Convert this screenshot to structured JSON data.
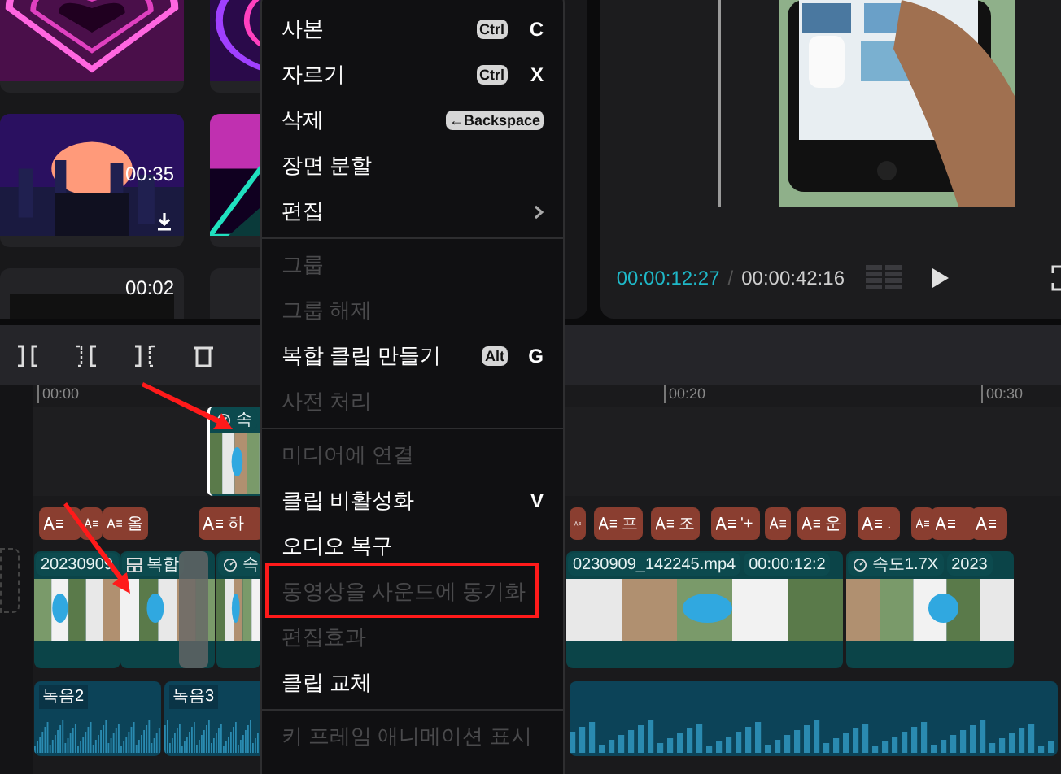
{
  "media": [
    {
      "download": false
    },
    {
      "download": false
    },
    {
      "duration": "00:35",
      "download": true
    },
    {
      "download": false
    },
    {
      "duration": "00:02",
      "download": false
    },
    {
      "download": false
    }
  ],
  "preview": {
    "current": "00:00:12:27",
    "separator": "/",
    "total": "00:00:42:16"
  },
  "ruler": [
    "00:00",
    "00:20",
    "00:30"
  ],
  "text_clips": [
    {
      "kind": "text"
    },
    {
      "kind": "text"
    },
    {
      "kind": "text",
      "label": "올"
    },
    {
      "kind": "text",
      "label": "하"
    },
    {
      "kind": "text"
    },
    {
      "kind": "text",
      "label": "프"
    },
    {
      "kind": "text",
      "label": "조"
    },
    {
      "kind": "text",
      "label": "'+"
    },
    {
      "kind": "text"
    },
    {
      "kind": "text",
      "label": "운"
    },
    {
      "kind": "text",
      "label": "."
    },
    {
      "kind": "text"
    },
    {
      "kind": "text"
    },
    {
      "kind": "text"
    }
  ],
  "video_clips": [
    {
      "tags": [
        {
          "kind": "text",
          "text": "20230909"
        }
      ]
    },
    {
      "tags": [
        {
          "kind": "compound",
          "text": "복합"
        }
      ]
    },
    {
      "tags": [
        {
          "kind": "speed",
          "text": "속"
        }
      ]
    },
    {
      "tags": [
        {
          "kind": "text",
          "text": "0230909_142245.mp4"
        },
        {
          "kind": "text",
          "text": "00:00:12:2"
        }
      ]
    },
    {
      "tags": [
        {
          "kind": "speed",
          "text": "속도1.7X"
        },
        {
          "kind": "text",
          "text": "2023"
        }
      ]
    }
  ],
  "overlay_clip": {
    "tags": [
      {
        "kind": "speed",
        "text": "속"
      }
    ]
  },
  "audio_clips": [
    {
      "kind": "audio",
      "label": "녹음2"
    },
    {
      "kind": "audio",
      "label": "녹음3"
    },
    {
      "kind": "audio"
    }
  ],
  "context_menu": [
    {
      "kind": "item",
      "label": "사본",
      "disabled": false,
      "highlighted": false,
      "key": "Ctrl",
      "letter": "C"
    },
    {
      "kind": "item",
      "label": "자르기",
      "disabled": false,
      "highlighted": false,
      "key": "Ctrl",
      "letter": "X"
    },
    {
      "kind": "item",
      "label": "삭제",
      "disabled": false,
      "highlighted": false,
      "key": "←Backspace"
    },
    {
      "kind": "item",
      "label": "장면 분할",
      "disabled": false,
      "highlighted": false
    },
    {
      "kind": "item",
      "label": "편집",
      "disabled": false,
      "highlighted": false,
      "submenu": true
    },
    {
      "kind": "separator"
    },
    {
      "kind": "item",
      "label": "그룹",
      "disabled": true,
      "highlighted": false
    },
    {
      "kind": "item",
      "label": "그룹 해제",
      "disabled": true,
      "highlighted": false
    },
    {
      "kind": "item",
      "label": "복합 클립 만들기",
      "disabled": false,
      "highlighted": false,
      "key": "Alt",
      "letter": "G"
    },
    {
      "kind": "item",
      "label": "사전 처리",
      "disabled": true,
      "highlighted": false
    },
    {
      "kind": "separator"
    },
    {
      "kind": "item",
      "label": "미디어에 연결",
      "disabled": true,
      "highlighted": false
    },
    {
      "kind": "item",
      "label": "클립 비활성화",
      "disabled": false,
      "highlighted": false,
      "letter": "V"
    },
    {
      "kind": "item",
      "label": "오디오 복구",
      "disabled": false,
      "highlighted": false
    },
    {
      "kind": "item",
      "label": "동영상을 사운드에 동기화",
      "disabled": true,
      "highlighted": true
    },
    {
      "kind": "item",
      "label": "편집효과",
      "disabled": true,
      "highlighted": false
    },
    {
      "kind": "item",
      "label": "클립 교체",
      "disabled": false,
      "highlighted": false
    },
    {
      "kind": "separator"
    },
    {
      "kind": "item",
      "label": "키 프레임 애니메이션 표시",
      "disabled": true,
      "highlighted": false
    }
  ]
}
